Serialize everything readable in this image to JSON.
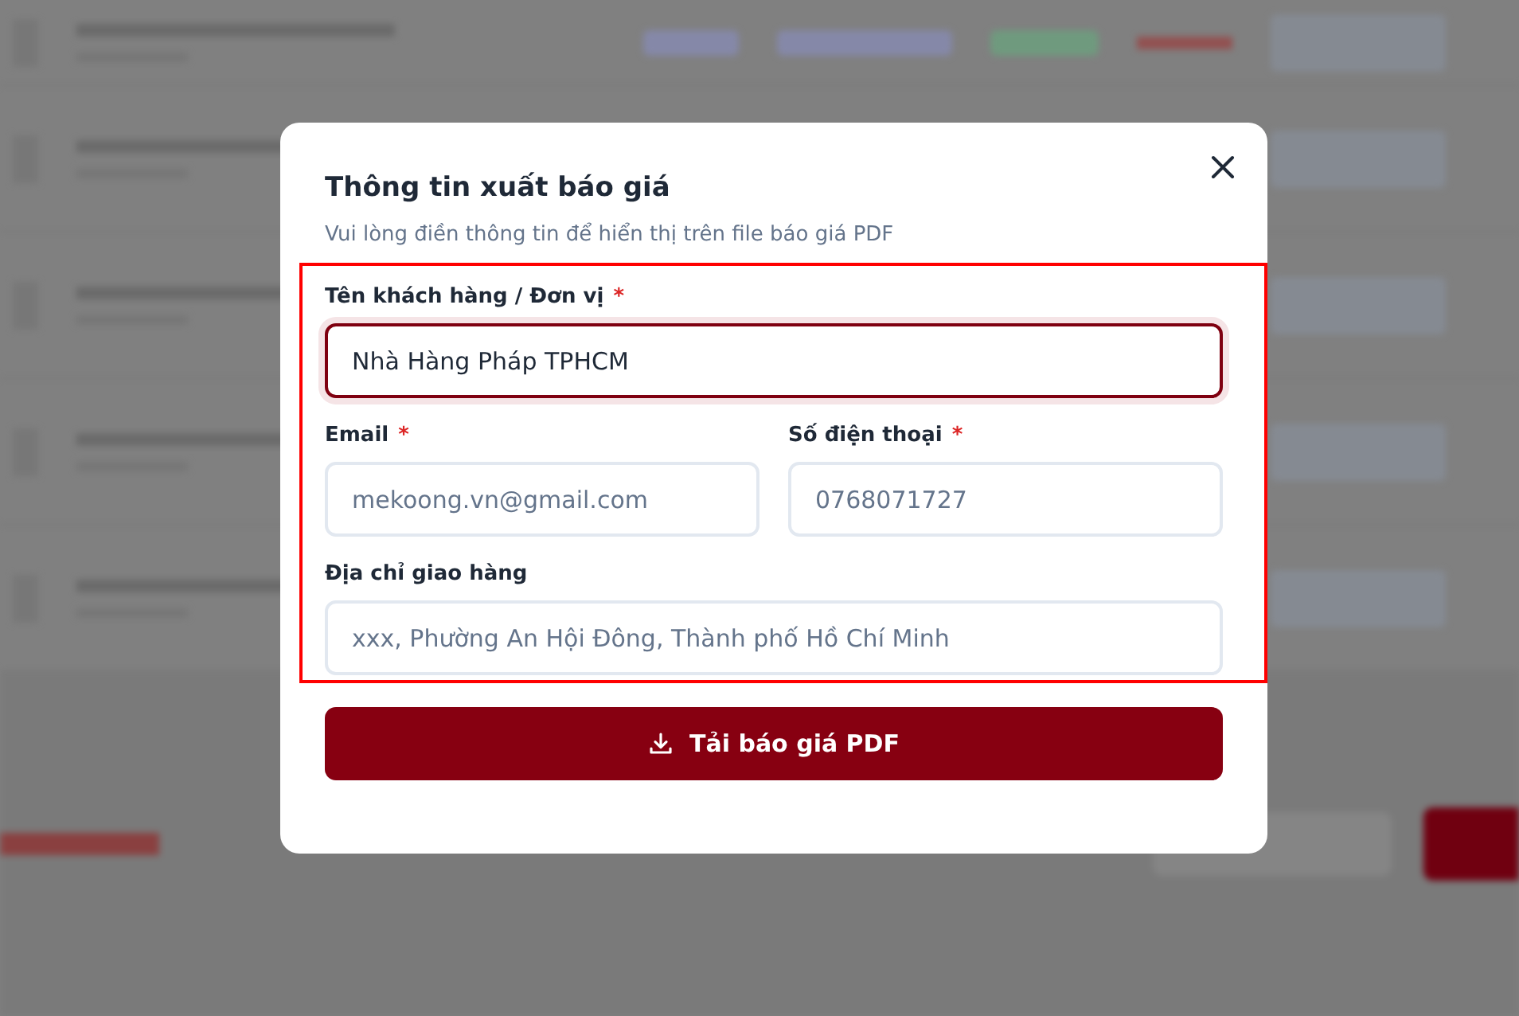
{
  "dialog": {
    "title": "Thông tin xuất báo giá",
    "subtitle": "Vui lòng điền thông tin để hiển thị trên file báo giá PDF",
    "fields": [
      {
        "label": "Tên khách hàng / Đơn vị",
        "required_mark": "*",
        "value": "Nhà Hàng Pháp TPHCM",
        "focused": true
      },
      {
        "label": "Email",
        "required_mark": "*",
        "placeholder": "mekoong.vn@gmail.com",
        "focused": false
      },
      {
        "label": "Số điện thoại",
        "required_mark": "*",
        "placeholder": "0768071727",
        "focused": false
      },
      {
        "label": "Địa chỉ giao hàng",
        "placeholder": "xxx, Phường An Hội Đông, Thành phố Hồ Chí Minh",
        "focused": false
      }
    ],
    "submit": "Tải báo giá PDF"
  }
}
